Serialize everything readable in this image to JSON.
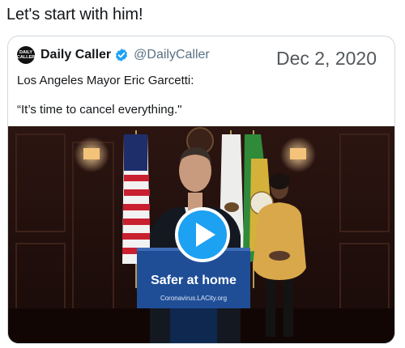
{
  "tweet": {
    "text": "Let's start with him!"
  },
  "quoted": {
    "avatar_text_line1": "DAILY",
    "avatar_text_line2": "CALLER",
    "display_name": "Daily Caller",
    "handle": "@DailyCaller",
    "date": "Dec 2, 2020",
    "line1": "Los Angeles Mayor Eric Garcetti:",
    "line2": "“It’s time to cancel everything.\""
  },
  "video": {
    "podium_title": "Safer at home",
    "podium_url": "Coronavirus.LACity.org",
    "play_icon": "play-icon"
  },
  "colors": {
    "accent": "#1da1f2",
    "podium": "#1f4e97",
    "room": "#2a1410",
    "text_secondary": "#5b7083"
  }
}
